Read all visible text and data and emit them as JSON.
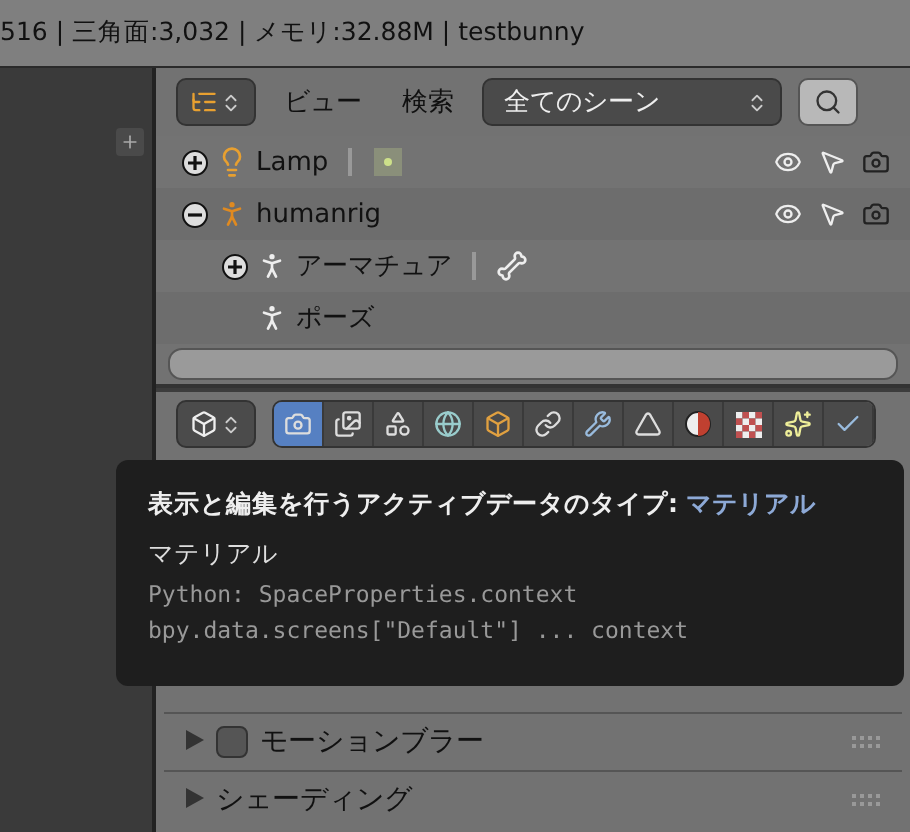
{
  "status_bar": {
    "text": "516 | 三角面:3,032 | メモリ:32.88M | testbunny"
  },
  "outliner": {
    "menus": [
      "ビュー",
      "検索"
    ],
    "scene_filter": "全てのシーン",
    "tree": [
      {
        "name": "Lamp",
        "kind": "lamp",
        "expanded": false
      },
      {
        "name": "humanrig",
        "kind": "armature_object",
        "expanded": true,
        "children": [
          {
            "name": "アーマチュア",
            "kind": "armature",
            "expanded": false
          },
          {
            "name": "ポーズ",
            "kind": "pose"
          }
        ]
      }
    ]
  },
  "properties": {
    "tabs": [
      {
        "kind": "render",
        "selected": true
      },
      {
        "kind": "layers",
        "selected": false
      },
      {
        "kind": "scene",
        "selected": false
      },
      {
        "kind": "world",
        "selected": false
      },
      {
        "kind": "object",
        "selected": false
      },
      {
        "kind": "constraints",
        "selected": false
      },
      {
        "kind": "modifiers",
        "selected": false
      },
      {
        "kind": "data",
        "selected": false
      },
      {
        "kind": "material",
        "selected": false
      },
      {
        "kind": "texture",
        "selected": false
      },
      {
        "kind": "particles",
        "selected": false
      },
      {
        "kind": "physics",
        "selected": false
      }
    ],
    "panels": [
      {
        "label": "モーションブラー",
        "expanded": false,
        "checked": false
      },
      {
        "label": "シェーディング",
        "expanded": false
      }
    ]
  },
  "tooltip": {
    "title": "表示と編集を行うアクティブデータのタイプ:",
    "value": "マテリアル",
    "subtitle": "マテリアル",
    "python": [
      "Python: SpaceProperties.context",
      "bpy.data.screens[\"Default\"] ... context"
    ]
  }
}
